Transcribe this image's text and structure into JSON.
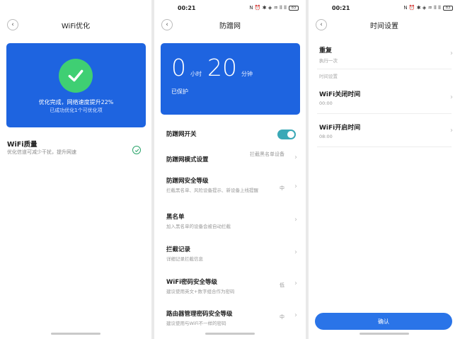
{
  "status_bar": {
    "time": "00:21",
    "icons_text": "N ⏰ ✱ ◈ ♒ ll ll",
    "battery": "83"
  },
  "screen1": {
    "title": "WiFi优化",
    "result_line1": "优化完成，网络速度提升22%",
    "result_line2": "已成功优化1个可优化项",
    "quality_title": "WiFi质量",
    "quality_sub": "优化信道可减少干扰，提升网速"
  },
  "screen2": {
    "title": "防蹭网",
    "timer": {
      "hours": "0",
      "hours_unit": "小时",
      "minutes": "20",
      "minutes_unit": "分钟",
      "status": "已保护"
    },
    "rows": [
      {
        "title": "防蹭网开关",
        "desc": "",
        "value": ""
      },
      {
        "title": "防蹭网模式设置",
        "desc": "",
        "value": "拦截黑名单设备"
      },
      {
        "title": "防蹭网安全等级",
        "desc": "拦截黑名单、风险设备提示、新设备上线提醒",
        "value": "中"
      },
      {
        "title": "黑名单",
        "desc": "加入黑名单的设备会被自动拦截",
        "value": ""
      },
      {
        "title": "拦截记录",
        "desc": "详细记录拦截信息",
        "value": ""
      },
      {
        "title": "WiFi密码安全等级",
        "desc": "建议使用英文+数字组合作为密码",
        "value": "低"
      },
      {
        "title": "路由器管理密码安全等级",
        "desc": "建议使用与WiFi不一样的密码",
        "value": "中"
      }
    ],
    "toggle_on": true,
    "accent": "#3aa8b6"
  },
  "screen3": {
    "title": "时间设置",
    "repeat_title": "重复",
    "repeat_sub": "执行一次",
    "section_label": "时间设置",
    "off_title": "WiFi关闭时间",
    "off_time": "00:00",
    "on_title": "WiFi开启时间",
    "on_time": "08:00",
    "confirm": "确认"
  },
  "colors": {
    "card_blue": "#1e64e0",
    "check_green": "#3fcf73",
    "confirm_blue": "#2a74e8"
  }
}
